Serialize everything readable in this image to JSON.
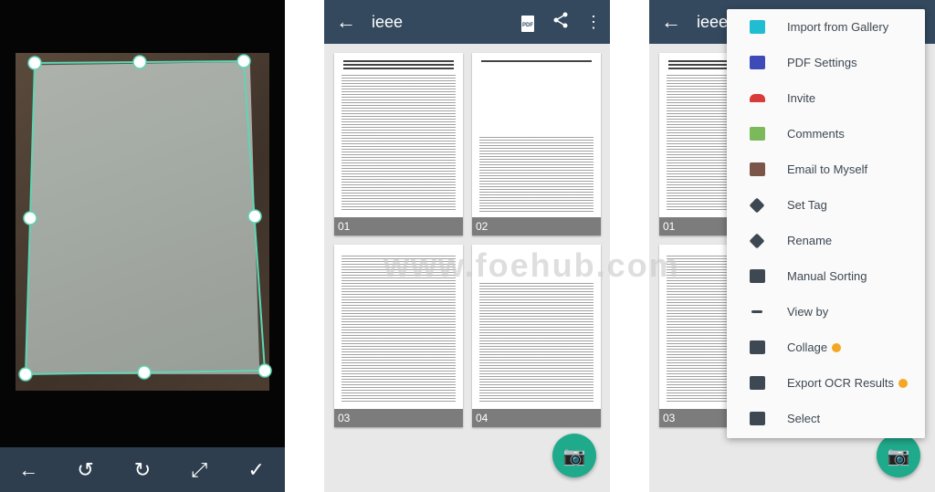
{
  "crop_screen": {
    "toolbar": [
      {
        "name": "back-icon",
        "glyph": "←"
      },
      {
        "name": "rotate-left-icon",
        "glyph": "↺"
      },
      {
        "name": "rotate-right-icon",
        "glyph": "↻"
      },
      {
        "name": "expand-icon",
        "glyph": "⤢"
      },
      {
        "name": "check-icon",
        "glyph": "✓"
      }
    ],
    "accent": "#5ed6b4"
  },
  "document": {
    "title": "ieee",
    "back": "←",
    "pdf_icon": "PDF",
    "share": "⋖",
    "more": "⋮",
    "pages": [
      "01",
      "02",
      "03",
      "04"
    ],
    "camera": "📷",
    "header_color": "#34495e",
    "fab_color": "#1faa8c"
  },
  "menu": {
    "items": [
      {
        "label": "Import from Gallery",
        "icon": "image-icon",
        "color": "#1fbcd2",
        "premium": false
      },
      {
        "label": "PDF Settings",
        "icon": "pdf-icon",
        "color": "#3d4ab7",
        "premium": false
      },
      {
        "label": "Invite",
        "icon": "add-group-icon",
        "color": "#d93a3a",
        "premium": false
      },
      {
        "label": "Comments",
        "icon": "comment-icon",
        "color": "#7cb95a",
        "premium": false
      },
      {
        "label": "Email to Myself",
        "icon": "envelope-icon",
        "color": "#7a5548",
        "premium": false
      },
      {
        "label": "Set Tag",
        "icon": "tag-icon",
        "color": "#3d4852",
        "premium": false
      },
      {
        "label": "Rename",
        "icon": "pencil-icon",
        "color": "#3d4852",
        "premium": false
      },
      {
        "label": "Manual Sorting",
        "icon": "sort-icon",
        "color": "#3d4852",
        "premium": false
      },
      {
        "label": "View by",
        "icon": "compress-icon",
        "color": "#3d4852",
        "premium": false
      },
      {
        "label": "Collage",
        "icon": "collage-icon",
        "color": "#3d4852",
        "premium": true
      },
      {
        "label": "Export OCR Results",
        "icon": "txt-file-icon",
        "color": "#3d4852",
        "premium": true
      },
      {
        "label": "Select",
        "icon": "checkbox-icon",
        "color": "#3d4852",
        "premium": false
      }
    ]
  },
  "watermark": "www.foehub.com"
}
